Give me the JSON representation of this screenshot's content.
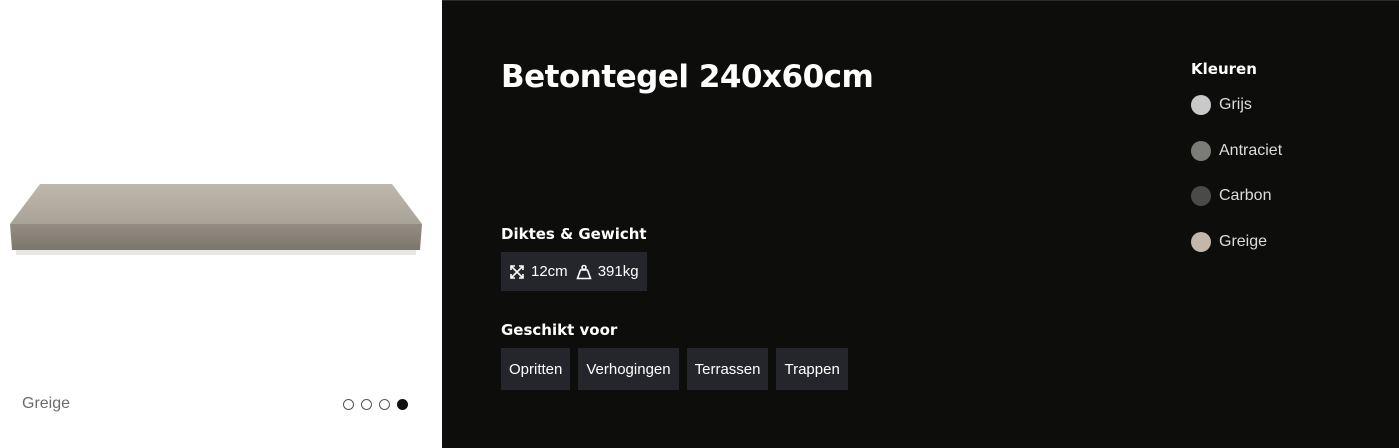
{
  "gallery": {
    "caption": "Greige",
    "slide_count": 4,
    "active_slide": 4
  },
  "product": {
    "title": "Betontegel 240x60cm",
    "specs_heading": "Diktes & Gewicht",
    "thickness": "12cm",
    "weight": "391kg",
    "suitable_heading": "Geschikt voor",
    "suitable_for": [
      "Opritten",
      "Verhogingen",
      "Terrassen",
      "Trappen"
    ]
  },
  "colors": {
    "heading": "Kleuren",
    "items": [
      {
        "label": "Grijs",
        "hex": "#c9c9c9"
      },
      {
        "label": "Antraciet",
        "hex": "#7b7b78"
      },
      {
        "label": "Carbon",
        "hex": "#4a4a48"
      },
      {
        "label": "Greige",
        "hex": "#c2b7aa"
      }
    ]
  }
}
